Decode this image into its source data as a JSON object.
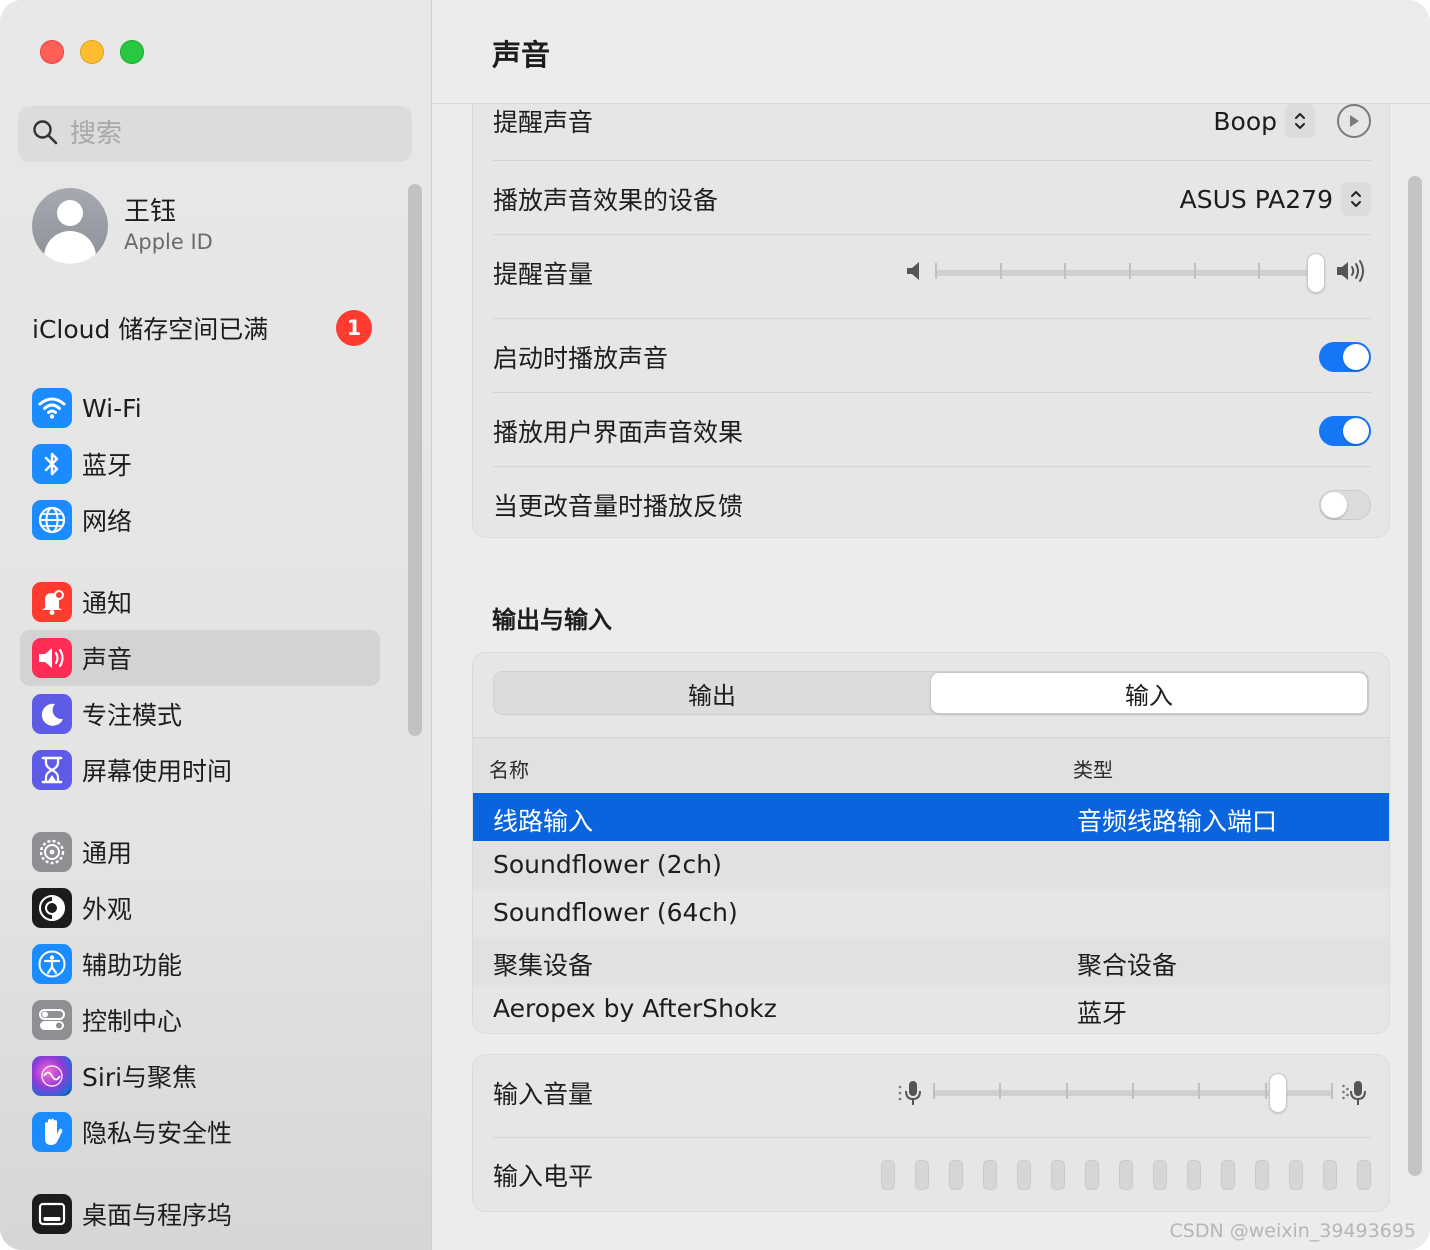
{
  "sidebar": {
    "search_placeholder": "搜索",
    "account": {
      "name": "王钰",
      "subtitle": "Apple ID"
    },
    "icloud": {
      "label": "iCloud 储存空间已满",
      "badge": "1"
    },
    "groups": [
      [
        {
          "label": "Wi-Fi",
          "icon": "wifi-icon",
          "color": "#1a8cff"
        },
        {
          "label": "蓝牙",
          "icon": "bluetooth-icon",
          "color": "#1a8cff"
        },
        {
          "label": "网络",
          "icon": "globe-icon",
          "color": "#1a8cff"
        }
      ],
      [
        {
          "label": "通知",
          "icon": "bell-icon",
          "color": "#ff3b30"
        },
        {
          "label": "声音",
          "icon": "speaker-icon",
          "color": "#ff2d55",
          "active": true
        },
        {
          "label": "专注模式",
          "icon": "moon-icon",
          "color": "#5e5ce6"
        },
        {
          "label": "屏幕使用时间",
          "icon": "hourglass-icon",
          "color": "#5e5ce6"
        }
      ],
      [
        {
          "label": "通用",
          "icon": "gear-icon",
          "color": "#8e8e93"
        },
        {
          "label": "外观",
          "icon": "appearance-icon",
          "color": "#1c1c1e"
        },
        {
          "label": "辅助功能",
          "icon": "accessibility-icon",
          "color": "#1a8cff"
        },
        {
          "label": "控制中心",
          "icon": "toggles-icon",
          "color": "#8e8e93"
        },
        {
          "label": "Siri与聚焦",
          "icon": "siri-icon",
          "color": "#b040c8"
        },
        {
          "label": "隐私与安全性",
          "icon": "hand-icon",
          "color": "#1a8cff"
        }
      ],
      [
        {
          "label": "桌面与程序坞",
          "icon": "dock-icon",
          "color": "#1c1c1e"
        }
      ]
    ]
  },
  "main": {
    "title": "声音",
    "effects": {
      "alert_sound_label": "提醒声音",
      "alert_sound_value": "Boop",
      "output_device_label": "播放声音效果的设备",
      "output_device_value": "ASUS PA279",
      "alert_volume_label": "提醒音量",
      "alert_volume_level": 1.0,
      "startup_sound_label": "启动时播放声音",
      "startup_sound_on": true,
      "ui_sound_label": "播放用户界面声音效果",
      "ui_sound_on": true,
      "volume_feedback_label": "当更改音量时播放反馈",
      "volume_feedback_on": false
    },
    "io": {
      "section_title": "输出与输入",
      "tabs": [
        "输出",
        "输入"
      ],
      "selected_tab": 1,
      "columns": [
        "名称",
        "类型"
      ],
      "devices": [
        {
          "name": "线路输入",
          "type": "音频线路输入端口",
          "selected": true
        },
        {
          "name": "Soundflower (2ch)",
          "type": ""
        },
        {
          "name": "Soundflower (64ch)",
          "type": ""
        },
        {
          "name": "聚集设备",
          "type": "聚合设备"
        },
        {
          "name": "Aeropex by AfterShokz",
          "type": "蓝牙"
        }
      ]
    },
    "input": {
      "volume_label": "输入音量",
      "volume_level": 0.88,
      "level_label": "输入电平",
      "level_bars_lit": 0
    }
  },
  "watermark": "CSDN @weixin_39493695",
  "colors": {
    "accent": "#1577f6",
    "selection": "#0a64dd",
    "badge": "#ff3b30"
  }
}
